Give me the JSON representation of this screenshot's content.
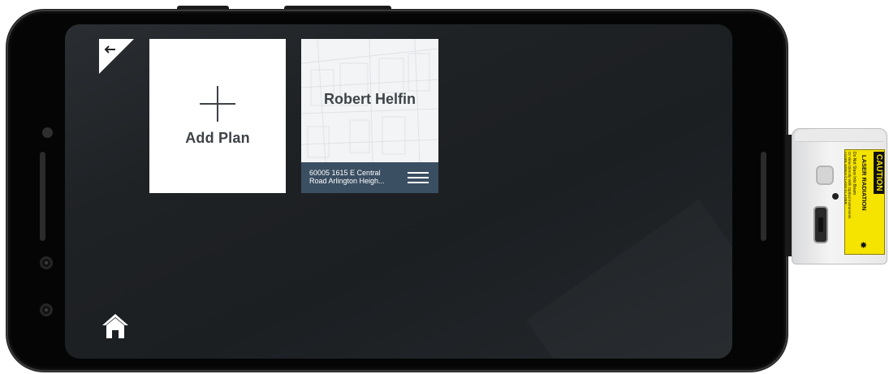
{
  "app": {
    "back_icon": "arrow-left-icon",
    "home_icon": "home-icon"
  },
  "tiles": {
    "add_plan": {
      "label": "Add Plan",
      "icon": "plus-icon"
    },
    "plans": [
      {
        "name": "Robert Helfin",
        "address": "60005 1615 E  Central\nRoad Arlington Heigh...",
        "menu_icon": "hamburger-menu-icon"
      }
    ]
  },
  "device": {
    "caution_label": "CAUTION",
    "laser_label": "LASER RADIATION",
    "warning_line1": "Do Not Stare Into Beam",
    "warning_line2": "Or View Directly With Optical Instruments",
    "class_line": "<1mW, 620nm CLASS II LASER"
  },
  "colors": {
    "screen_bg": "#1f2225",
    "plan_footer": "#3b4f63",
    "tile_text": "#3d4247",
    "caution_yellow": "#f5e300"
  }
}
